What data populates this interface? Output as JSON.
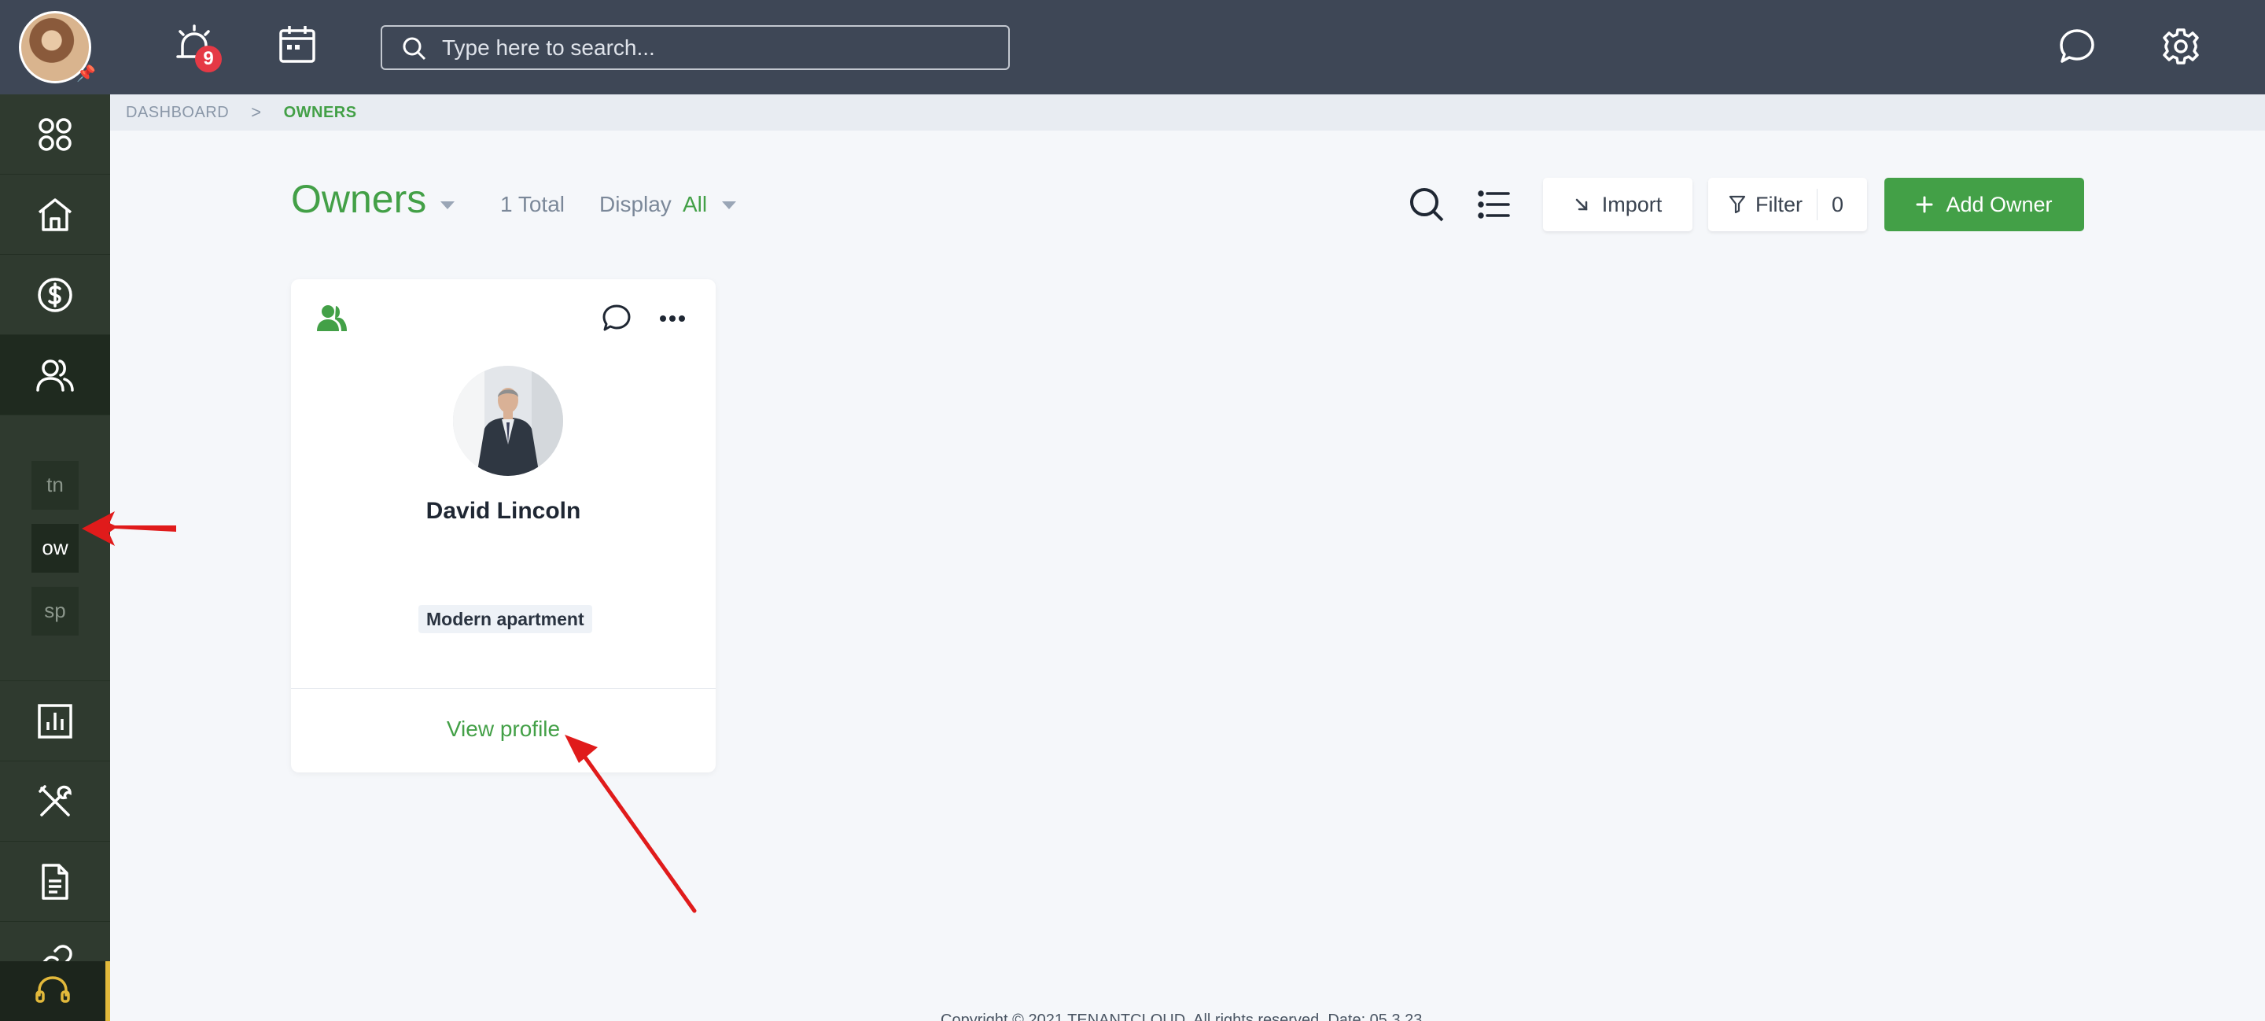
{
  "topbar": {
    "notification_count": "9",
    "search_placeholder": "Type here to search..."
  },
  "breadcrumb": {
    "items": [
      "DASHBOARD",
      "OWNERS"
    ],
    "separator": ">"
  },
  "sidebar": {
    "icons": [
      "apps-icon",
      "home-icon",
      "dollar-icon",
      "users-icon",
      "chart-icon",
      "tools-icon",
      "document-icon",
      "link-icon",
      "headset-icon"
    ],
    "sub_items": [
      "tn",
      "ow",
      "sp"
    ],
    "active_sub_item": "ow"
  },
  "header": {
    "title": "Owners",
    "total": "1 Total",
    "display_label": "Display",
    "display_value": "All"
  },
  "actions": {
    "import_label": "Import",
    "filter_label": "Filter",
    "filter_count": "0",
    "add_label": "Add Owner"
  },
  "owners": [
    {
      "name": "David Lincoln",
      "property": "Modern apartment",
      "view_label": "View profile"
    }
  ],
  "footer": {
    "text": "Copyright © 2021 TENANTCLOUD. All rights reserved. Date: 05.3.23"
  },
  "colors": {
    "accent": "#43a047",
    "topbar": "#3e4756",
    "sidebar": "#2f3a2f",
    "badge": "#e53945",
    "annotation": "#e01b1b"
  }
}
